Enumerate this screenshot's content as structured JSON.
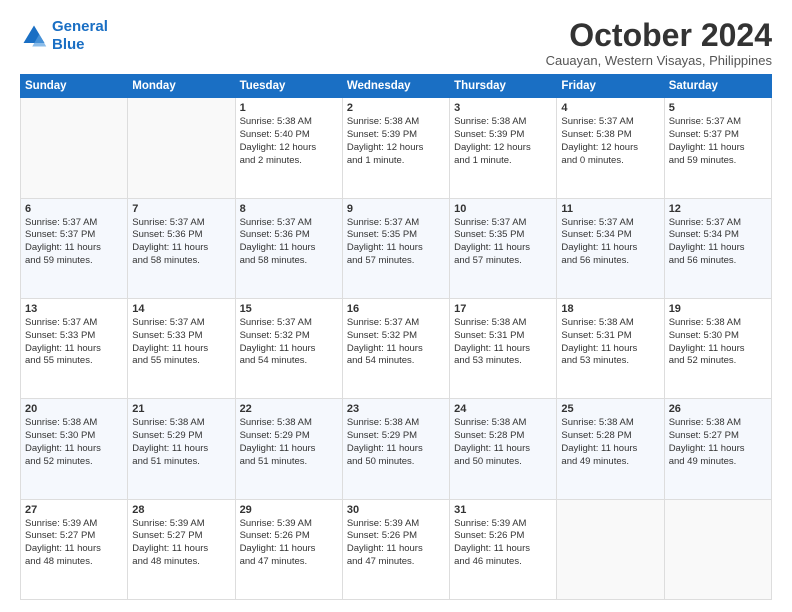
{
  "logo": {
    "line1": "General",
    "line2": "Blue"
  },
  "title": "October 2024",
  "location": "Cauayan, Western Visayas, Philippines",
  "headers": [
    "Sunday",
    "Monday",
    "Tuesday",
    "Wednesday",
    "Thursday",
    "Friday",
    "Saturday"
  ],
  "weeks": [
    [
      {
        "day": "",
        "lines": []
      },
      {
        "day": "",
        "lines": []
      },
      {
        "day": "1",
        "lines": [
          "Sunrise: 5:38 AM",
          "Sunset: 5:40 PM",
          "Daylight: 12 hours",
          "and 2 minutes."
        ]
      },
      {
        "day": "2",
        "lines": [
          "Sunrise: 5:38 AM",
          "Sunset: 5:39 PM",
          "Daylight: 12 hours",
          "and 1 minute."
        ]
      },
      {
        "day": "3",
        "lines": [
          "Sunrise: 5:38 AM",
          "Sunset: 5:39 PM",
          "Daylight: 12 hours",
          "and 1 minute."
        ]
      },
      {
        "day": "4",
        "lines": [
          "Sunrise: 5:37 AM",
          "Sunset: 5:38 PM",
          "Daylight: 12 hours",
          "and 0 minutes."
        ]
      },
      {
        "day": "5",
        "lines": [
          "Sunrise: 5:37 AM",
          "Sunset: 5:37 PM",
          "Daylight: 11 hours",
          "and 59 minutes."
        ]
      }
    ],
    [
      {
        "day": "6",
        "lines": [
          "Sunrise: 5:37 AM",
          "Sunset: 5:37 PM",
          "Daylight: 11 hours",
          "and 59 minutes."
        ]
      },
      {
        "day": "7",
        "lines": [
          "Sunrise: 5:37 AM",
          "Sunset: 5:36 PM",
          "Daylight: 11 hours",
          "and 58 minutes."
        ]
      },
      {
        "day": "8",
        "lines": [
          "Sunrise: 5:37 AM",
          "Sunset: 5:36 PM",
          "Daylight: 11 hours",
          "and 58 minutes."
        ]
      },
      {
        "day": "9",
        "lines": [
          "Sunrise: 5:37 AM",
          "Sunset: 5:35 PM",
          "Daylight: 11 hours",
          "and 57 minutes."
        ]
      },
      {
        "day": "10",
        "lines": [
          "Sunrise: 5:37 AM",
          "Sunset: 5:35 PM",
          "Daylight: 11 hours",
          "and 57 minutes."
        ]
      },
      {
        "day": "11",
        "lines": [
          "Sunrise: 5:37 AM",
          "Sunset: 5:34 PM",
          "Daylight: 11 hours",
          "and 56 minutes."
        ]
      },
      {
        "day": "12",
        "lines": [
          "Sunrise: 5:37 AM",
          "Sunset: 5:34 PM",
          "Daylight: 11 hours",
          "and 56 minutes."
        ]
      }
    ],
    [
      {
        "day": "13",
        "lines": [
          "Sunrise: 5:37 AM",
          "Sunset: 5:33 PM",
          "Daylight: 11 hours",
          "and 55 minutes."
        ]
      },
      {
        "day": "14",
        "lines": [
          "Sunrise: 5:37 AM",
          "Sunset: 5:33 PM",
          "Daylight: 11 hours",
          "and 55 minutes."
        ]
      },
      {
        "day": "15",
        "lines": [
          "Sunrise: 5:37 AM",
          "Sunset: 5:32 PM",
          "Daylight: 11 hours",
          "and 54 minutes."
        ]
      },
      {
        "day": "16",
        "lines": [
          "Sunrise: 5:37 AM",
          "Sunset: 5:32 PM",
          "Daylight: 11 hours",
          "and 54 minutes."
        ]
      },
      {
        "day": "17",
        "lines": [
          "Sunrise: 5:38 AM",
          "Sunset: 5:31 PM",
          "Daylight: 11 hours",
          "and 53 minutes."
        ]
      },
      {
        "day": "18",
        "lines": [
          "Sunrise: 5:38 AM",
          "Sunset: 5:31 PM",
          "Daylight: 11 hours",
          "and 53 minutes."
        ]
      },
      {
        "day": "19",
        "lines": [
          "Sunrise: 5:38 AM",
          "Sunset: 5:30 PM",
          "Daylight: 11 hours",
          "and 52 minutes."
        ]
      }
    ],
    [
      {
        "day": "20",
        "lines": [
          "Sunrise: 5:38 AM",
          "Sunset: 5:30 PM",
          "Daylight: 11 hours",
          "and 52 minutes."
        ]
      },
      {
        "day": "21",
        "lines": [
          "Sunrise: 5:38 AM",
          "Sunset: 5:29 PM",
          "Daylight: 11 hours",
          "and 51 minutes."
        ]
      },
      {
        "day": "22",
        "lines": [
          "Sunrise: 5:38 AM",
          "Sunset: 5:29 PM",
          "Daylight: 11 hours",
          "and 51 minutes."
        ]
      },
      {
        "day": "23",
        "lines": [
          "Sunrise: 5:38 AM",
          "Sunset: 5:29 PM",
          "Daylight: 11 hours",
          "and 50 minutes."
        ]
      },
      {
        "day": "24",
        "lines": [
          "Sunrise: 5:38 AM",
          "Sunset: 5:28 PM",
          "Daylight: 11 hours",
          "and 50 minutes."
        ]
      },
      {
        "day": "25",
        "lines": [
          "Sunrise: 5:38 AM",
          "Sunset: 5:28 PM",
          "Daylight: 11 hours",
          "and 49 minutes."
        ]
      },
      {
        "day": "26",
        "lines": [
          "Sunrise: 5:38 AM",
          "Sunset: 5:27 PM",
          "Daylight: 11 hours",
          "and 49 minutes."
        ]
      }
    ],
    [
      {
        "day": "27",
        "lines": [
          "Sunrise: 5:39 AM",
          "Sunset: 5:27 PM",
          "Daylight: 11 hours",
          "and 48 minutes."
        ]
      },
      {
        "day": "28",
        "lines": [
          "Sunrise: 5:39 AM",
          "Sunset: 5:27 PM",
          "Daylight: 11 hours",
          "and 48 minutes."
        ]
      },
      {
        "day": "29",
        "lines": [
          "Sunrise: 5:39 AM",
          "Sunset: 5:26 PM",
          "Daylight: 11 hours",
          "and 47 minutes."
        ]
      },
      {
        "day": "30",
        "lines": [
          "Sunrise: 5:39 AM",
          "Sunset: 5:26 PM",
          "Daylight: 11 hours",
          "and 47 minutes."
        ]
      },
      {
        "day": "31",
        "lines": [
          "Sunrise: 5:39 AM",
          "Sunset: 5:26 PM",
          "Daylight: 11 hours",
          "and 46 minutes."
        ]
      },
      {
        "day": "",
        "lines": []
      },
      {
        "day": "",
        "lines": []
      }
    ]
  ]
}
